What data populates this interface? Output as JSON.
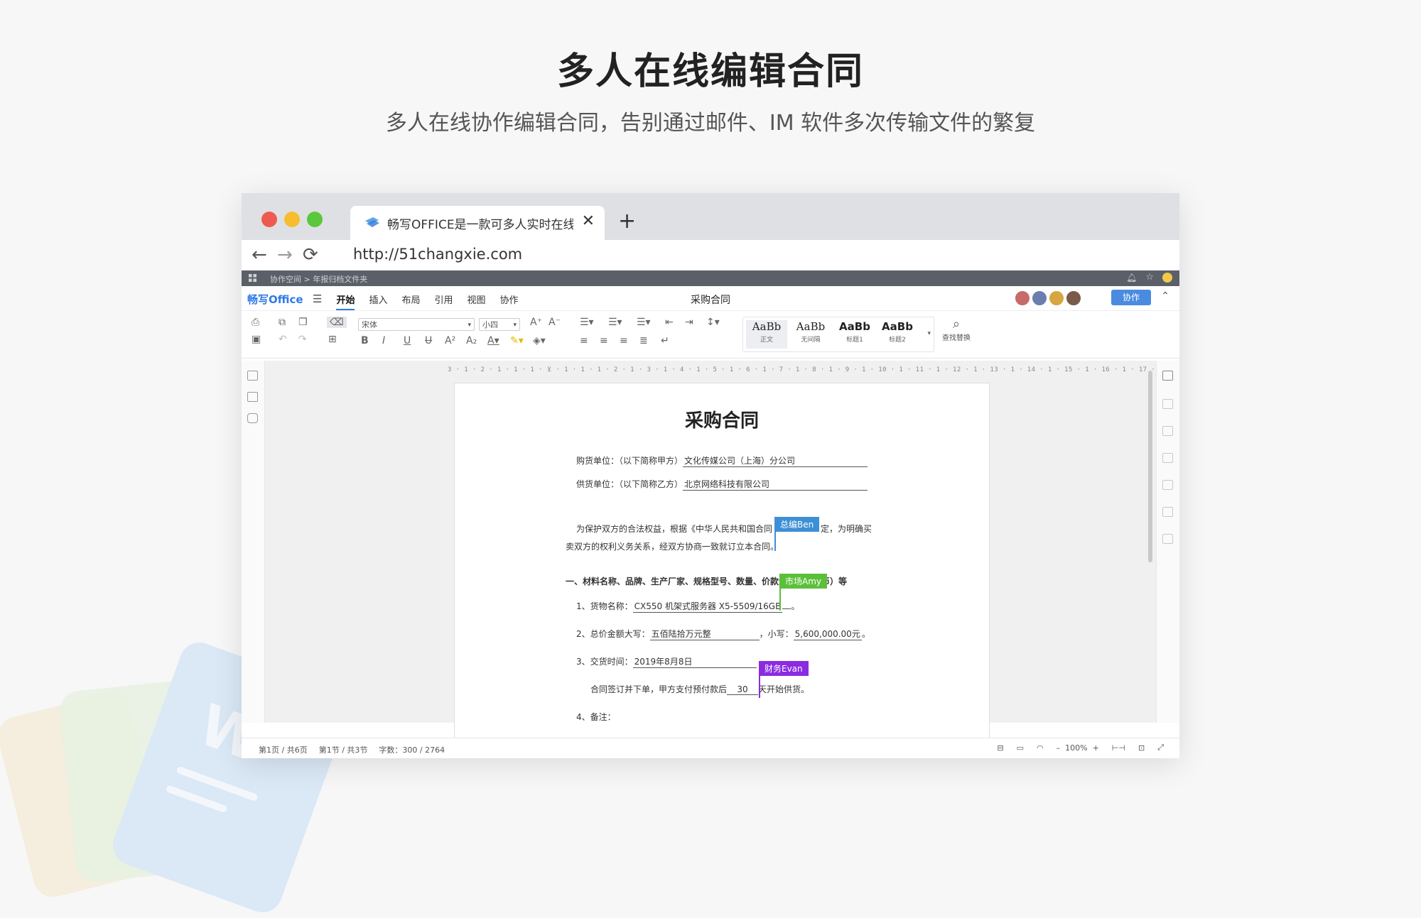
{
  "hero": {
    "title": "多人在线编辑合同",
    "subtitle": "多人在线协作编辑合同，告别通过邮件、IM 软件多次传输文件的繁复"
  },
  "browser": {
    "tab_title": "畅写OFFICE是一款可多人实时在线编辑的Office",
    "url": "http://51changxie.com",
    "new_tab": "+",
    "close": "✕"
  },
  "app": {
    "breadcrumb": "协作空间  >  年报归档文件夹",
    "logo": "畅写Office",
    "menu": [
      "开始",
      "插入",
      "布局",
      "引用",
      "视图",
      "协作"
    ],
    "active_menu": "开始",
    "doc_title": "采购合同",
    "collab_button": "协作",
    "avatar_colors": [
      "#c86a6a",
      "#6a7fb0",
      "#d6a640",
      "#7a5a4a"
    ]
  },
  "toolbar": {
    "font_family": "宋体",
    "font_size": "小四",
    "styles": [
      {
        "preview": "AaBb",
        "name": "正文",
        "bold": false
      },
      {
        "preview": "AaBb",
        "name": "无间隔",
        "bold": false
      },
      {
        "preview": "AaBb",
        "name": "标题1",
        "bold": true
      },
      {
        "preview": "AaBb",
        "name": "标题2",
        "bold": true
      }
    ],
    "find_replace": "查找替换"
  },
  "ruler": "3 · 1 · 2 · 1 · 1 · 1 · ⊻ · 1 · 1 · 1 · 2 · 1 · 3 · 1 · 4 · 1 · 5 · 1 · 6 · 1 · 7 · 1 · 8 · 1 · 9 · 1 · 10 · 1 · 11 · 1 · 12 · 1 · 13 · 1 · 14 · 1 · 15 · 1 · 16 · 1 · 17 · 1 · 18",
  "document": {
    "heading": "采购合同",
    "buyer_label": "购货单位：（以下简称甲方）",
    "buyer_value": "文化传媒公司（上海）分公司",
    "supplier_label": "供货单位：（以下简称乙方）",
    "supplier_value": "北京网络科技有限公司",
    "para1_a": "为保护双方的合法权益，根据《中华人民共和国合同",
    "para1_b": "定，为明确买",
    "para2": "卖双方的权利义务关系，经双方协商一致就订立本合同。",
    "section1": "一、材料名称、品牌、生产厂家、规格型号、数量、价款金额（人民币）等",
    "item1_label": "1、货物名称：",
    "item1_value": "CX550 机架式服务器 X5-5509/16GB",
    "item1_end": "。",
    "item2_label": "2、总价金额大写：",
    "item2_value": "五佰陆拾万元整",
    "item2_mid": "，小写：",
    "item2_value2": "5,600,000.00元",
    "item2_end": "。",
    "item3_label": "3、交货时间：",
    "item3_value": "2019年8月8日",
    "item3_sub_a": "合同签订并下单，甲方支付预付款后",
    "item3_days": "30",
    "item3_sub_b": "天开始供货。",
    "item4_label": "4、备注："
  },
  "collaborators": [
    {
      "name": "总编Ben",
      "color": "#3d8fd6"
    },
    {
      "name": "市场Amy",
      "color": "#5cbf3a"
    },
    {
      "name": "财务Evan",
      "color": "#8a2be2"
    }
  ],
  "status": {
    "page": "第1页 / 共6页",
    "section": "第1节 / 共3节",
    "words": "字数：300 / 2764",
    "zoom": "100%"
  }
}
